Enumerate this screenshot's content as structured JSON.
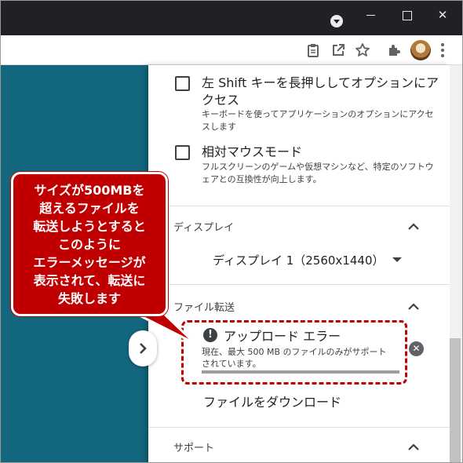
{
  "toolbar": {
    "icons": [
      "clipboard-icon",
      "external-link-icon",
      "star-icon",
      "extensions-icon",
      "avatar",
      "more-menu-icon"
    ]
  },
  "panel": {
    "options": [
      {
        "title": "左 Shift キーを長押ししてオプションにアクセス",
        "description": "キーボードを使ってアプリケーションのオプションにアクセスします",
        "checked": false
      },
      {
        "title": "相対マウスモード",
        "description": "フルスクリーンのゲームや仮想マシンなど、特定のソフトウェアとの互換性が向上します。",
        "checked": false
      }
    ],
    "display_section": {
      "title": "ディスプレイ",
      "selected": "ディスプレイ 1（2560x1440）"
    },
    "file_transfer_section": {
      "title": "ファイル転送",
      "error_title": "アップロード エラー",
      "error_message": "現在、最大 500 MB のファイルのみがサポートされています。",
      "download_label": "ファイルをダウンロード"
    },
    "support_section": {
      "title": "サポート"
    }
  },
  "callout": {
    "text": "サイズが500MBを\n超えるファイルを\n転送しようとすると\nこのように\nエラーメッセージが\n表示されて、転送に\n失敗します"
  },
  "colors": {
    "accent_red": "#c00000",
    "left_background": "#12677f",
    "titlebar": "#202124"
  }
}
